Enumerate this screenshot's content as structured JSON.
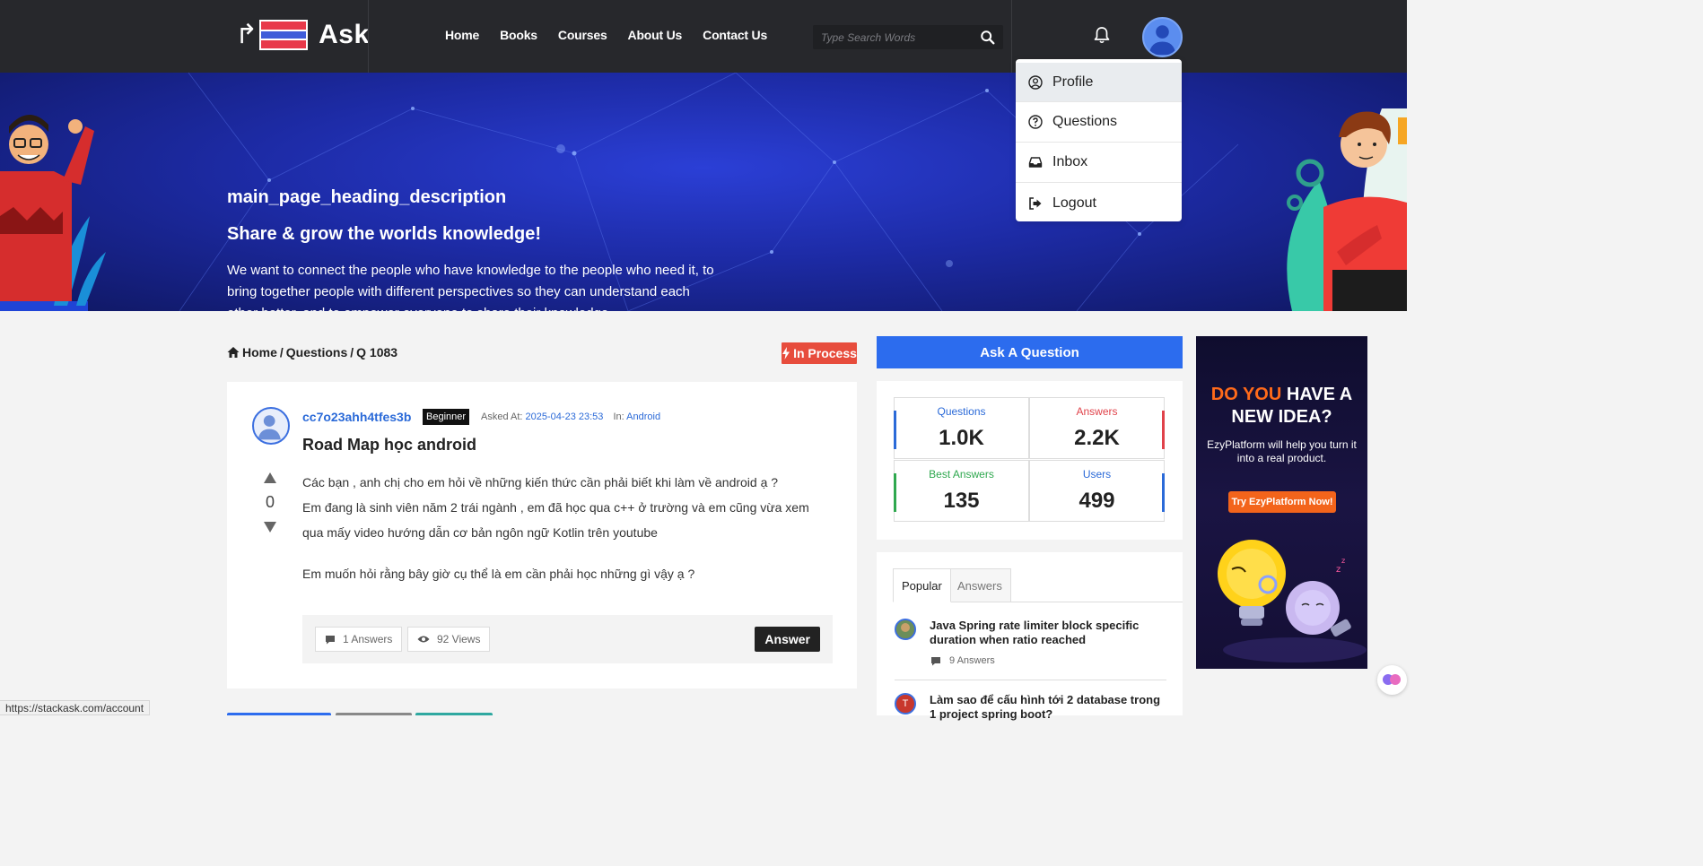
{
  "header": {
    "logo_text": "Ask",
    "nav": [
      "Home",
      "Books",
      "Courses",
      "About Us",
      "Contact Us"
    ],
    "search_placeholder": "Type Search Words"
  },
  "account_menu": {
    "items": [
      "Profile",
      "Questions",
      "Inbox",
      "Logout"
    ],
    "active": "Profile"
  },
  "hero": {
    "heading": "main_page_heading_description",
    "subheading": "Share & grow the worlds knowledge!",
    "description": "We want to connect the people who have knowledge to the people who need it, to bring together people with different perspectives so they can understand each other better, and to empower everyone to share their knowledge."
  },
  "breadcrumb": {
    "home": "Home",
    "sep": "/",
    "questions": "Questions",
    "current": "Q 1083"
  },
  "status_badge": "In Process",
  "question": {
    "user": "cc7o23ahh4tfes3b",
    "badge": "Beginner",
    "asked_label": "Asked At:",
    "asked_at": "2025-04-23 23:53",
    "in_label": "In:",
    "category": "Android",
    "title": "Road Map học android",
    "votes": "0",
    "body": [
      "Các bạn , anh chị cho em hỏi về những kiến thức cần phải biết khi làm về android ạ ?",
      "Em đang là sinh viên năm 2 trái ngành , em đã học qua c++ ở trường và em cũng vừa xem qua mấy video hướng dẫn cơ bản ngôn ngữ Kotlin trên youtube",
      "Em muốn hỏi rằng bây giờ cụ thể là em cần phải học những gì vậy ạ ?"
    ],
    "answers_count": "1 Answers",
    "views_count": "92 Views",
    "answer_button": "Answer"
  },
  "sidebar": {
    "ask_button": "Ask A Question",
    "stats": {
      "questions_label": "Questions",
      "questions_value": "1.0K",
      "answers_label": "Answers",
      "answers_value": "2.2K",
      "best_label": "Best Answers",
      "best_value": "135",
      "users_label": "Users",
      "users_value": "499"
    },
    "tabs": [
      "Popular",
      "Answers"
    ],
    "popular": [
      {
        "title": "Java Spring rate limiter block specific duration when ratio reached",
        "answers": "9 Answers"
      },
      {
        "title": "Làm sao để cấu hình tới 2 database trong 1 project spring boot?",
        "avatar_letter": "T"
      }
    ]
  },
  "ad": {
    "headline_highlight": "DO YOU",
    "headline_rest": "HAVE A NEW IDEA?",
    "subtext": "EzyPlatform will help you turn it into a real product.",
    "button": "Try EzyPlatform Now!"
  },
  "status_url": "https://stackask.com/account",
  "colors": {
    "primary": "#2c6cee",
    "status_red": "#e74c3c",
    "header_bg": "#27282c",
    "questions_blue": "#2b6ad8",
    "answers_red": "#e0424a",
    "best_green": "#2fa84f",
    "users_blue": "#2b6ad8",
    "ad_orange": "#f3641b"
  }
}
